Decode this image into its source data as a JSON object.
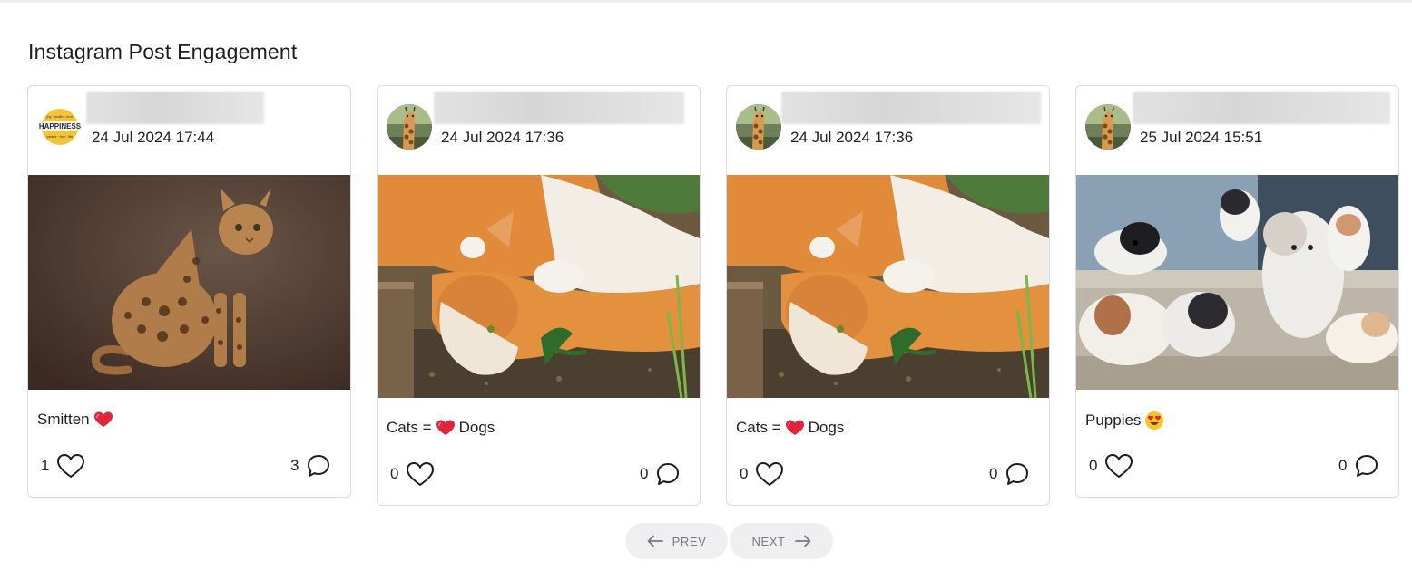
{
  "page": {
    "title": "Instagram Post Engagement"
  },
  "posts": [
    {
      "date": "24 Jul 2024 17:44",
      "caption_text": "Smitten",
      "caption_emoji": "heart-emoji",
      "likes": "1",
      "comments": "3",
      "avatar": "happiness-logo",
      "image": "bengal-cat-photo"
    },
    {
      "date": "24 Jul 2024 17:36",
      "caption_before": "Cats =",
      "caption_emoji": "heart-emoji",
      "caption_after": "Dogs",
      "likes": "0",
      "comments": "0",
      "avatar": "giraffe-avatar",
      "image": "cats-cuddling-photo"
    },
    {
      "date": "24 Jul 2024 17:36",
      "caption_before": "Cats =",
      "caption_emoji": "heart-emoji",
      "caption_after": "Dogs",
      "likes": "0",
      "comments": "0",
      "avatar": "giraffe-avatar",
      "image": "cats-cuddling-photo"
    },
    {
      "date": "25 Jul 2024 15:51",
      "caption_text": "Puppies",
      "caption_emoji": "heart-eyes-emoji",
      "likes": "0",
      "comments": "0",
      "avatar": "giraffe-avatar",
      "image": "puppies-photo"
    }
  ],
  "pagination": {
    "prev_label": "PREV",
    "next_label": "NEXT"
  },
  "colors": {
    "card_border": "#d9dbea",
    "pager_bg": "#efeff1",
    "pager_text": "#7a7a7a",
    "heart_red": "#e0243a"
  }
}
